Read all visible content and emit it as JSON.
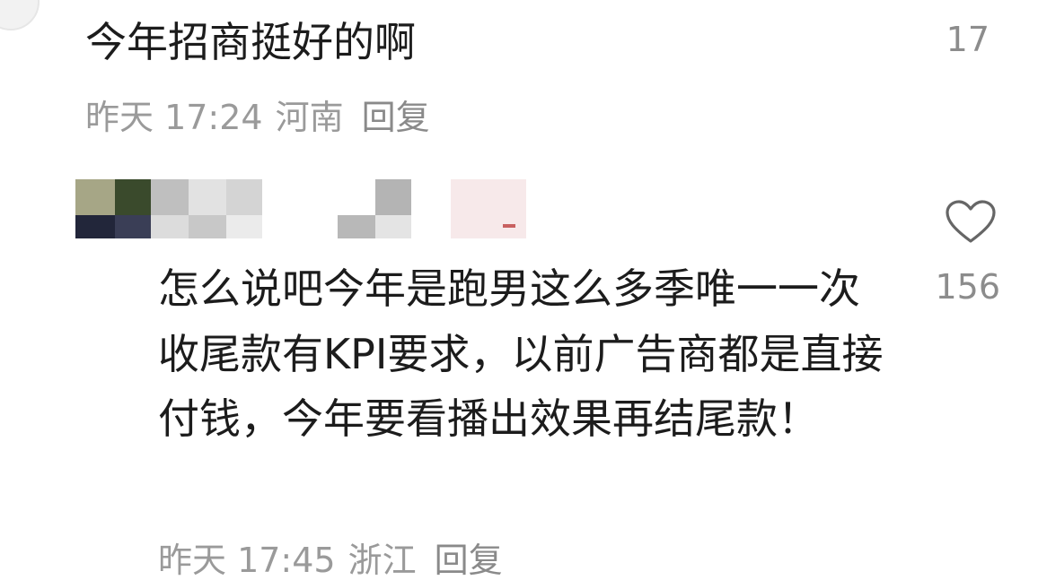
{
  "comment": {
    "text": "今年招商挺好的啊",
    "time": "昨天 17:24",
    "location": "河南",
    "reply_label": "回复",
    "likes": "17"
  },
  "reply": {
    "text": "怎么说吧今年是跑男这么多季唯一一次收尾款有KPI要求，以前广告商都是直接付钱，今年要看播出效果再结尾款！",
    "time": "昨天 17:45",
    "location": "浙江",
    "reply_label": "回复",
    "likes": "156",
    "username_state": "pixelated",
    "like_icon": "heart-outline-icon"
  }
}
